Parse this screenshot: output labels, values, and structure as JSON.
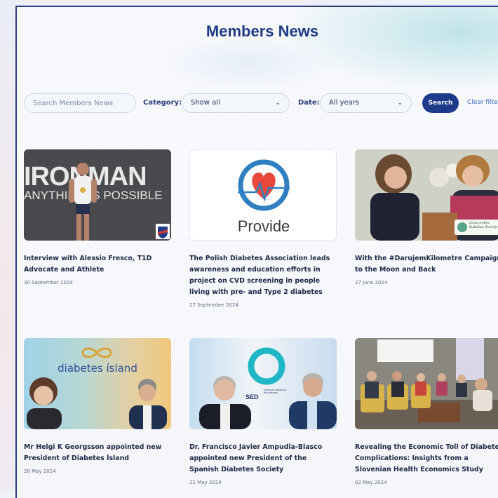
{
  "page_title": "Members News",
  "filters": {
    "search_placeholder": "Search Members News",
    "category_label": "Category:",
    "category_value": "Show all",
    "date_label": "Date:",
    "date_value": "All years",
    "search_button": "Search",
    "clear_link": "Clear filters"
  },
  "articles": [
    {
      "title": "Interview with Alessio Fresco, T1D Advocate and Athlete",
      "date": "30 September 2024",
      "image_text": {
        "wordmark": "IRONMAN",
        "tagline": "ANYTHING IS POSSIBLE"
      }
    },
    {
      "title": "The Polish Diabetes Association leads awareness and education efforts in project on CVD screening in people living with pre- and Type 2 diabetes",
      "date": "27 September 2024",
      "image_text": {
        "logo": "Provide"
      }
    },
    {
      "title": "With the #DarujemKilometre Campaign to the Moon and Back",
      "date": "27 June 2024",
      "image_text": {
        "badge": "Zveza društev Diabetikov Slovenije"
      }
    },
    {
      "title": "Mr Helgi K Georgsson appointed new President of Diabetes Ísland",
      "date": "28 May 2024",
      "image_text": {
        "logo": "diabetes ísland"
      }
    },
    {
      "title": "Dr. Francisco Javier Ampudia-Blasco appointed new President of the Spanish Diabetes Society",
      "date": "21 May 2024",
      "image_text": {
        "logo": "SED",
        "logo_sub": "SOCIEDAD ESPAÑOLA DE DIABETES"
      }
    },
    {
      "title": "Revealing the Economic Toll of Diabetes Complications: Insights from a Slovenian Health Economics Study",
      "date": "02 May 2024",
      "image_text": {}
    }
  ],
  "colors": {
    "accent": "#1e3a8a",
    "title": "#1f3a86",
    "link": "#3a67c4",
    "heart": "#e8493b",
    "ring": "#2f7fc1"
  }
}
